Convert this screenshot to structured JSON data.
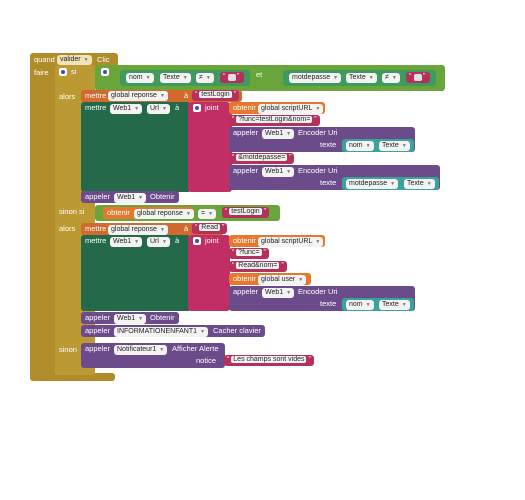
{
  "colors": {
    "event": "#b08c2a",
    "control": "#bb9a33",
    "logic": "#6aa53b",
    "variable": "#d26a2e",
    "variable_get": "#e5772f",
    "component": "#6c4b8a",
    "component_set": "#24694a",
    "text": "#b5305a",
    "math": "#3f9b5d",
    "text_join": "#c12e66"
  },
  "event": {
    "when": "quand",
    "component": "valider",
    "event_name": "Clic",
    "do": "faire"
  },
  "if_block": {
    "if_label": "si",
    "then_label": "alors",
    "elseif_label": "sinon si",
    "else_label": "sinon"
  },
  "cond1": {
    "name_get": "nom",
    "name_prop": "Texte",
    "neq": "≠",
    "and_label": "et",
    "pwd_get": "motdepasse",
    "pwd_prop": "Texte",
    "neq2": "≠"
  },
  "then1": {
    "set_label": "mettre",
    "var": "global reponse",
    "to": "à",
    "value": "testLogin",
    "set2_label": "mettre",
    "comp": "Web1",
    "prop": "Url",
    "to2": "à",
    "join_label": "joint",
    "get_label": "obtenir",
    "get_var": "global scriptURL",
    "text1": "?func=testLogin&nom=",
    "call1": "appeler",
    "call1_comp": "Web1",
    "call1_method": "Encoder Uri",
    "call1_param": "texte",
    "call1_arg": "nom",
    "call1_arg_prop": "Texte",
    "text2": "&motdepasse=",
    "call2": "appeler",
    "call2_comp": "Web1",
    "call2_method": "Encoder Uri",
    "call2_param": "texte",
    "call2_arg": "motdepasse",
    "call2_arg_prop": "Texte",
    "call3": "appeler",
    "call3_comp": "Web1",
    "call3_method": "Obtenir"
  },
  "cond2": {
    "get_label": "obtenir",
    "var": "global reponse",
    "eq": "=",
    "value": "testLogin"
  },
  "then2": {
    "set_label": "mettre",
    "var": "global reponse",
    "to": "à",
    "value": "Read",
    "set2_label": "mettre",
    "comp": "Web1",
    "prop": "Url",
    "to2": "à",
    "join_label": "joint",
    "get_label": "obtenir",
    "get_var": "global scriptURL",
    "text1": "?func=",
    "text2": "Read&nom=",
    "get2_label": "obtenir",
    "get2_var": "global user",
    "call1": "appeler",
    "call1_comp": "Web1",
    "call1_method": "Encoder Uri",
    "call1_param": "texte",
    "call1_arg": "nom",
    "call1_arg_prop": "Texte",
    "call2": "appeler",
    "call2_comp": "Web1",
    "call2_method": "Obtenir",
    "call3": "appeler",
    "call3_comp": "INFORMATIONENFANT1",
    "call3_method": "Cacher clavier"
  },
  "else1": {
    "call": "appeler",
    "comp": "Notificateur1",
    "method": "Afficher Alerte",
    "param": "notice",
    "message": "Les champs sont vides"
  }
}
